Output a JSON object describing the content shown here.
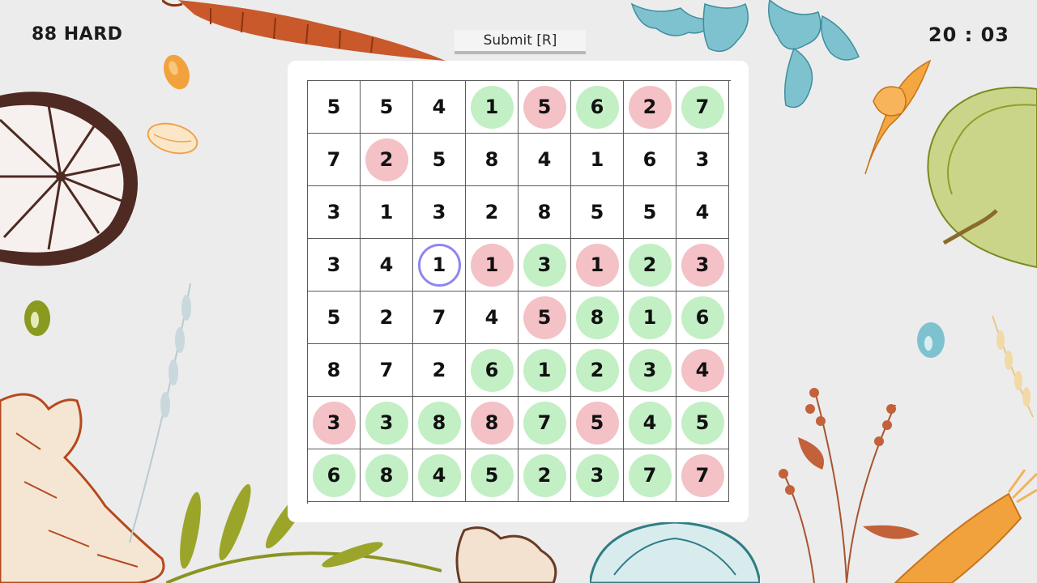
{
  "header": {
    "level": "88 HARD",
    "submit_label": "Submit [R]",
    "timer": "20 : 03"
  },
  "colors": {
    "background": "#ececec",
    "shaded_green": "#c2efc4",
    "shaded_pink": "#f3c1c6",
    "selection_ring": "#8f86ee",
    "grid_line": "#5a5a5a"
  },
  "board": {
    "rows": [
      [
        {
          "v": "5",
          "s": "none"
        },
        {
          "v": "5",
          "s": "none"
        },
        {
          "v": "4",
          "s": "none"
        },
        {
          "v": "1",
          "s": "green"
        },
        {
          "v": "5",
          "s": "pink"
        },
        {
          "v": "6",
          "s": "green"
        },
        {
          "v": "2",
          "s": "pink"
        },
        {
          "v": "7",
          "s": "green"
        }
      ],
      [
        {
          "v": "7",
          "s": "none"
        },
        {
          "v": "2",
          "s": "pink"
        },
        {
          "v": "5",
          "s": "none"
        },
        {
          "v": "8",
          "s": "none"
        },
        {
          "v": "4",
          "s": "none"
        },
        {
          "v": "1",
          "s": "none"
        },
        {
          "v": "6",
          "s": "none"
        },
        {
          "v": "3",
          "s": "none"
        }
      ],
      [
        {
          "v": "3",
          "s": "none"
        },
        {
          "v": "1",
          "s": "none"
        },
        {
          "v": "3",
          "s": "none"
        },
        {
          "v": "2",
          "s": "none"
        },
        {
          "v": "8",
          "s": "none"
        },
        {
          "v": "5",
          "s": "none"
        },
        {
          "v": "5",
          "s": "none"
        },
        {
          "v": "4",
          "s": "none"
        }
      ],
      [
        {
          "v": "3",
          "s": "none"
        },
        {
          "v": "4",
          "s": "none"
        },
        {
          "v": "1",
          "s": "selected"
        },
        {
          "v": "1",
          "s": "pink"
        },
        {
          "v": "3",
          "s": "green"
        },
        {
          "v": "1",
          "s": "pink"
        },
        {
          "v": "2",
          "s": "green"
        },
        {
          "v": "3",
          "s": "pink"
        }
      ],
      [
        {
          "v": "5",
          "s": "none"
        },
        {
          "v": "2",
          "s": "none"
        },
        {
          "v": "7",
          "s": "none"
        },
        {
          "v": "4",
          "s": "none"
        },
        {
          "v": "5",
          "s": "pink"
        },
        {
          "v": "8",
          "s": "green"
        },
        {
          "v": "1",
          "s": "green"
        },
        {
          "v": "6",
          "s": "green"
        }
      ],
      [
        {
          "v": "8",
          "s": "none"
        },
        {
          "v": "7",
          "s": "none"
        },
        {
          "v": "2",
          "s": "none"
        },
        {
          "v": "6",
          "s": "green"
        },
        {
          "v": "1",
          "s": "green"
        },
        {
          "v": "2",
          "s": "green"
        },
        {
          "v": "3",
          "s": "green"
        },
        {
          "v": "4",
          "s": "pink"
        }
      ],
      [
        {
          "v": "3",
          "s": "pink"
        },
        {
          "v": "3",
          "s": "green"
        },
        {
          "v": "8",
          "s": "green"
        },
        {
          "v": "8",
          "s": "pink"
        },
        {
          "v": "7",
          "s": "green"
        },
        {
          "v": "5",
          "s": "pink"
        },
        {
          "v": "4",
          "s": "green"
        },
        {
          "v": "5",
          "s": "green"
        }
      ],
      [
        {
          "v": "6",
          "s": "green"
        },
        {
          "v": "8",
          "s": "green"
        },
        {
          "v": "4",
          "s": "green"
        },
        {
          "v": "5",
          "s": "green"
        },
        {
          "v": "2",
          "s": "green"
        },
        {
          "v": "3",
          "s": "green"
        },
        {
          "v": "7",
          "s": "green"
        },
        {
          "v": "7",
          "s": "pink"
        }
      ]
    ]
  },
  "decorations": [
    "carrot-illustration",
    "orange-half-illustration",
    "bean-illustration",
    "parsley-illustration",
    "chili-pepper-illustration",
    "apple-illustration",
    "ginger-root-illustration",
    "wheat-illustration",
    "olive-branch-illustration",
    "herb-flower-illustration",
    "teal-apple-illustration"
  ]
}
